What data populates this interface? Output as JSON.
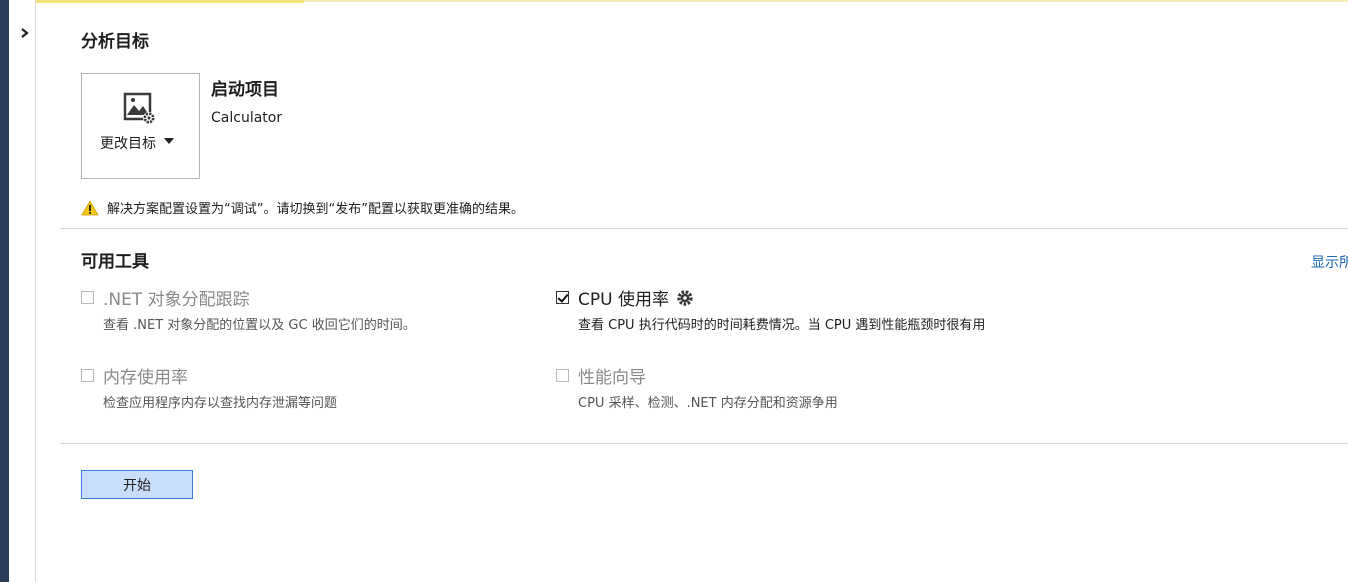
{
  "target_section": {
    "title": "分析目标",
    "change_target_label": "更改目标",
    "startup_title": "启动项目",
    "startup_name": "Calculator",
    "warning_text": "解决方案配置设置为“调试”。请切换到“发布”配置以获取更准确的结果。"
  },
  "tools_section": {
    "title": "可用工具",
    "show_more_link": "显示所",
    "tools": [
      {
        "label": ".NET 对象分配跟踪",
        "description": "查看 .NET 对象分配的位置以及 GC 收回它们的时间。",
        "checked": false,
        "enabled": false
      },
      {
        "label": "CPU 使用率",
        "description": "查看 CPU 执行代码时的时间耗费情况。当 CPU 遇到性能瓶颈时很有用",
        "checked": true,
        "enabled": true
      },
      {
        "label": "内存使用率",
        "description": "检查应用程序内存以查找内存泄漏等问题",
        "checked": false,
        "enabled": false
      },
      {
        "label": "性能向导",
        "description": "CPU 采样、检测、.NET 内存分配和资源争用",
        "checked": false,
        "enabled": false
      }
    ]
  },
  "actions": {
    "start_button": "开始"
  },
  "icons": {
    "expand": "chevron-right-icon",
    "target": "target-settings-icon",
    "dropdown": "caret-down-icon",
    "warning": "warning-icon",
    "settings": "gear-icon"
  },
  "colors": {
    "link": "#1a66b3",
    "start_button_bg": "#c9defa",
    "start_button_border": "#3c7fd6",
    "warning_yellow": "#f2c811",
    "sidebar_dark": "#2d3b5a"
  }
}
